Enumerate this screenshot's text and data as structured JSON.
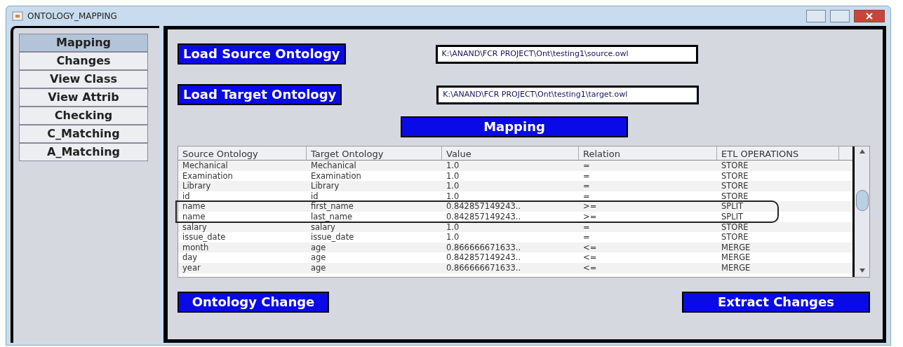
{
  "window": {
    "title": "ONTOLOGY_MAPPING"
  },
  "tabs": [
    {
      "label": "Mapping",
      "selected": true
    },
    {
      "label": "Changes",
      "selected": false
    },
    {
      "label": "View Class",
      "selected": false
    },
    {
      "label": "View Attrib",
      "selected": false
    },
    {
      "label": "Checking",
      "selected": false
    },
    {
      "label": "C_Matching",
      "selected": false
    },
    {
      "label": "A_Matching",
      "selected": false
    }
  ],
  "source": {
    "button": "Load Source Ontology",
    "value": "K:\\ANAND\\FCR PROJECT\\Ont\\testing1\\source.owl"
  },
  "target": {
    "button": "Load Target Ontology",
    "value": "K:\\ANAND\\FCR PROJECT\\Ont\\testing1\\target.owl"
  },
  "mapping_button": "Mapping",
  "table": {
    "columns": [
      "Source Ontology",
      "Target Ontology",
      "Value",
      "Relation",
      "ETL OPERATIONS"
    ],
    "rows": [
      {
        "cells": [
          "Mechanical",
          "Mechanical",
          "1.0",
          "=",
          "STORE"
        ],
        "highlighted": false
      },
      {
        "cells": [
          "Examination",
          "Examination",
          "1.0",
          "=",
          "STORE"
        ],
        "highlighted": false
      },
      {
        "cells": [
          "Library",
          "Library",
          "1.0",
          "=",
          "STORE"
        ],
        "highlighted": false
      },
      {
        "cells": [
          "id",
          "id",
          "1.0",
          "=",
          "STORE"
        ],
        "highlighted": false
      },
      {
        "cells": [
          "name",
          "first_name",
          "0.842857149243..",
          ">=",
          "SPLIT"
        ],
        "highlighted": true
      },
      {
        "cells": [
          "name",
          "last_name",
          "0.842857149243..",
          ">=",
          "SPLIT"
        ],
        "highlighted": true
      },
      {
        "cells": [
          "salary",
          "salary",
          "1.0",
          "=",
          "STORE"
        ],
        "highlighted": false
      },
      {
        "cells": [
          "issue_date",
          "issue_date",
          "1.0",
          "=",
          "STORE"
        ],
        "highlighted": false
      },
      {
        "cells": [
          "month",
          "age",
          "0.866666671633..",
          "<=",
          "MERGE"
        ],
        "highlighted": false
      },
      {
        "cells": [
          "day",
          "age",
          "0.842857149243..",
          "<=",
          "MERGE"
        ],
        "highlighted": false
      },
      {
        "cells": [
          "year",
          "age",
          "0.866666671633..",
          "<=",
          "MERGE"
        ],
        "highlighted": false
      }
    ]
  },
  "bottom_buttons": [
    "Ontology Change",
    "Extract Changes"
  ]
}
